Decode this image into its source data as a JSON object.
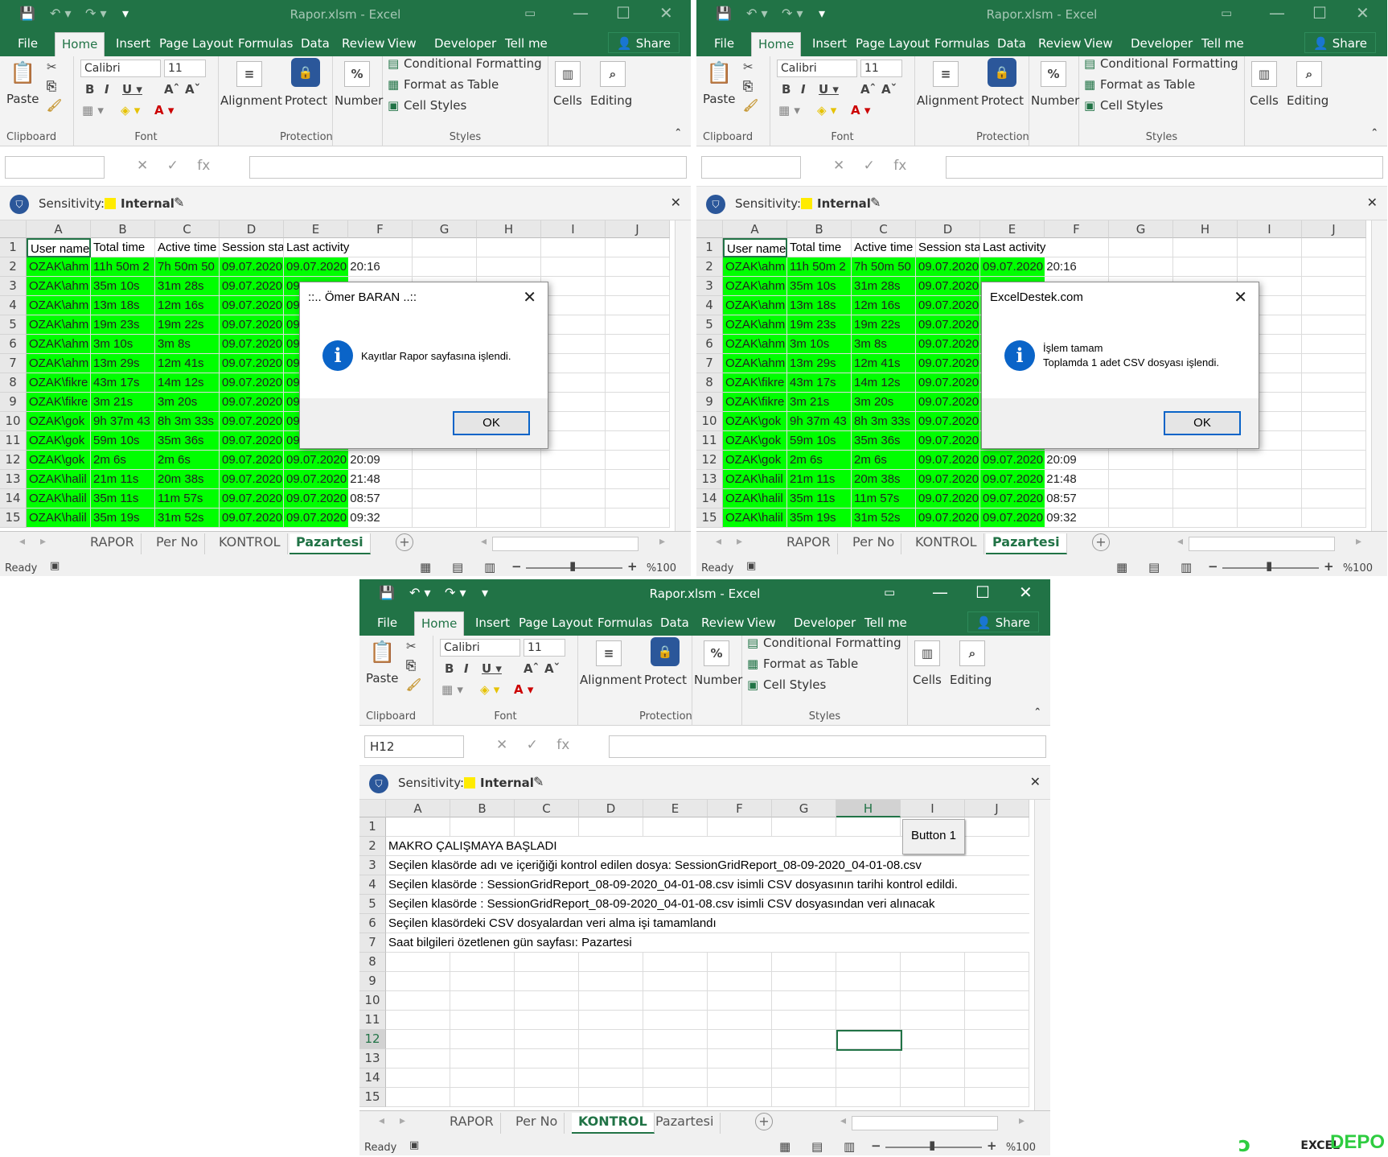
{
  "colors": {
    "excel_green": "#217346",
    "highlight": "#00ff00",
    "sensitivity": "#ffeb00",
    "dialog_blue": "#0a64c8"
  },
  "app": {
    "title": "Rapor.xlsm - Excel"
  },
  "menu": {
    "items": [
      "File",
      "Home",
      "Insert",
      "Page Layout",
      "Formulas",
      "Data",
      "Review",
      "View",
      "Developer",
      "Tell me"
    ],
    "share": "Share"
  },
  "ribbon": {
    "paste": "Paste",
    "clipboard": "Clipboard",
    "font_name": "Calibri",
    "font_size": "11",
    "font": "Font",
    "alignment": "Alignment",
    "protect": "Protect",
    "protection": "Protection",
    "number": "Number",
    "number_icon": "%",
    "conditional": "Conditional Formatting",
    "format_table": "Format as Table",
    "cell_styles": "Cell Styles",
    "styles": "Styles",
    "cells": "Cells",
    "editing": "Editing"
  },
  "sensitivity": {
    "label": "Sensitivity:",
    "value": "Internal"
  },
  "columns": [
    "A",
    "B",
    "C",
    "D",
    "E",
    "F",
    "G",
    "H",
    "I",
    "J"
  ],
  "rows": [
    "1",
    "2",
    "3",
    "4",
    "5",
    "6",
    "7",
    "8",
    "9",
    "10",
    "11",
    "12",
    "13",
    "14",
    "15"
  ],
  "pazartesi": {
    "header": [
      "User name",
      "Total time",
      "Active time",
      "Session sta",
      "Last activity"
    ],
    "data": [
      [
        "OZAK\\ahm",
        "11h 50m 2",
        "7h 50m 50",
        "09.07.2020",
        "09.07.2020 20:16"
      ],
      [
        "OZAK\\ahm",
        "35m 10s",
        "31m 28s",
        "09.07.2020",
        "09.07.2020"
      ],
      [
        "OZAK\\ahm",
        "13m 18s",
        "12m 16s",
        "09.07.2020",
        "09.07.2020"
      ],
      [
        "OZAK\\ahm",
        "19m 23s",
        "19m 22s",
        "09.07.2020",
        "09.07.2020"
      ],
      [
        "OZAK\\ahm",
        "3m 10s",
        "3m 8s",
        "09.07.2020",
        "09.07.2020"
      ],
      [
        "OZAK\\ahm",
        "13m 29s",
        "12m 41s",
        "09.07.2020",
        "09.07.2020"
      ],
      [
        "OZAK\\fikre",
        "43m 17s",
        "14m 12s",
        "09.07.2020",
        "09.07.2020"
      ],
      [
        "OZAK\\fikre",
        "3m 21s",
        "3m 20s",
        "09.07.2020",
        "09.07.2020"
      ],
      [
        "OZAK\\gok",
        "9h 37m 43",
        "8h 3m 33s",
        "09.07.2020",
        "09.07.2020"
      ],
      [
        "OZAK\\gok",
        "59m 10s",
        "35m 36s",
        "09.07.2020",
        "09.07.2020"
      ],
      [
        "OZAK\\gok",
        "2m 6s",
        "2m 6s",
        "09.07.2020",
        "09.07.2020 20:09"
      ],
      [
        "OZAK\\halil",
        "21m 11s",
        "20m 38s",
        "09.07.2020",
        "09.07.2020 21:48"
      ],
      [
        "OZAK\\halil",
        "35m 11s",
        "11m 57s",
        "09.07.2020",
        "09.07.2020 08:57"
      ],
      [
        "OZAK\\halil",
        "35m 19s",
        "31m 52s",
        "09.07.2020",
        "09.07.2020 09:32"
      ]
    ],
    "data_w2_c": [
      "7h 50m 50",
      "31m 28s",
      "12m 16s",
      "19m 22s",
      "3m 8s",
      "12m 41s",
      "14m 12s",
      "3m 20s",
      "8h 3m 33s",
      "35m 36s",
      "2m 6s",
      "20m 38s",
      "11m 57s",
      "31m 52s"
    ]
  },
  "tabs": [
    "RAPOR",
    "Per No",
    "KONTROL",
    "Pazartesi"
  ],
  "status": {
    "ready": "Ready",
    "zoom": "%100"
  },
  "dialog1": {
    "title": "::.. Ömer BARAN ..::",
    "message": "Kayıtlar Rapor sayfasına işlendi.",
    "ok": "OK"
  },
  "dialog2": {
    "title": "ExcelDestek.com",
    "line1": "İşlem tamam",
    "line2": "Toplamda 1 adet CSV dosyası işlendi.",
    "ok": "OK"
  },
  "kontrol": {
    "namebox": "H12",
    "button": "Button 1",
    "lines": [
      "MAKRO ÇALIŞMAYA BAŞLADI",
      "Seçilen klasörde adı ve içeriğiği kontrol edilen dosya: SessionGridReport_08-09-2020_04-01-08.csv",
      "Seçilen klasörde : SessionGridReport_08-09-2020_04-01-08.csv isimli CSV dosyasının tarihi kontrol edildi.",
      "Seçilen klasörde : SessionGridReport_08-09-2020_04-01-08.csv isimli CSV dosyasından veri alınacak",
      "Seçilen klasördeki CSV dosyalardan veri alma işi tamamlandı",
      "Saat bilgileri özetlenen gün sayfası: Pazartesi"
    ]
  },
  "watermark": {
    "text": "DEPO",
    "prefix": "EXCEL"
  }
}
